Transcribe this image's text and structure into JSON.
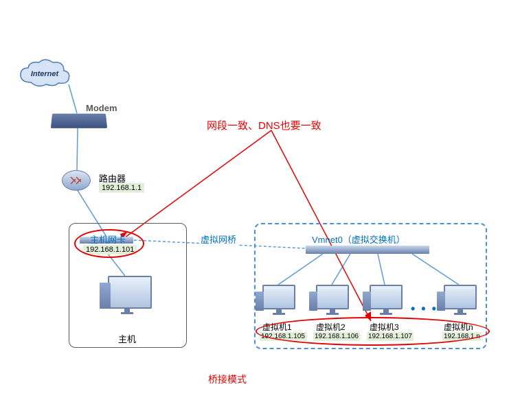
{
  "internet": {
    "label": "Internet"
  },
  "modem": {
    "label": "Modem"
  },
  "router": {
    "label": "路由器",
    "ip": "192.168.1.1"
  },
  "host_nic": {
    "label": "主机网卡",
    "ip": "192.168.1.101"
  },
  "virtual_bridge": {
    "label": "虚拟网桥"
  },
  "vmnet": {
    "label": "Vmnet0（虚拟交换机）"
  },
  "host": {
    "label": "主机"
  },
  "vms": [
    {
      "label": "虚拟机1",
      "ip": "192.168.1.105"
    },
    {
      "label": "虚拟机2",
      "ip": "192.168.1.106"
    },
    {
      "label": "虚拟机3",
      "ip": "192.168.1.107"
    },
    {
      "label": "虚拟机n",
      "ip": "192.168.1.n"
    }
  ],
  "dots": "• • •",
  "annotation": "网段一致、DNS也要一致",
  "title": "桥接模式"
}
